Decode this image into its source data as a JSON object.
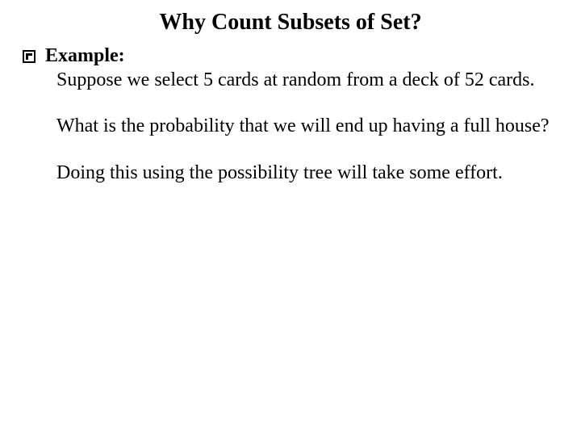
{
  "title": "Why Count Subsets of Set?",
  "example_label": "Example:",
  "paragraphs": {
    "p1": "Suppose we select 5 cards at random from a deck of 52 cards.",
    "p2": "What is the probability that we will end up having a full house?",
    "p3": "Doing this using the possibility tree will take some effort."
  }
}
